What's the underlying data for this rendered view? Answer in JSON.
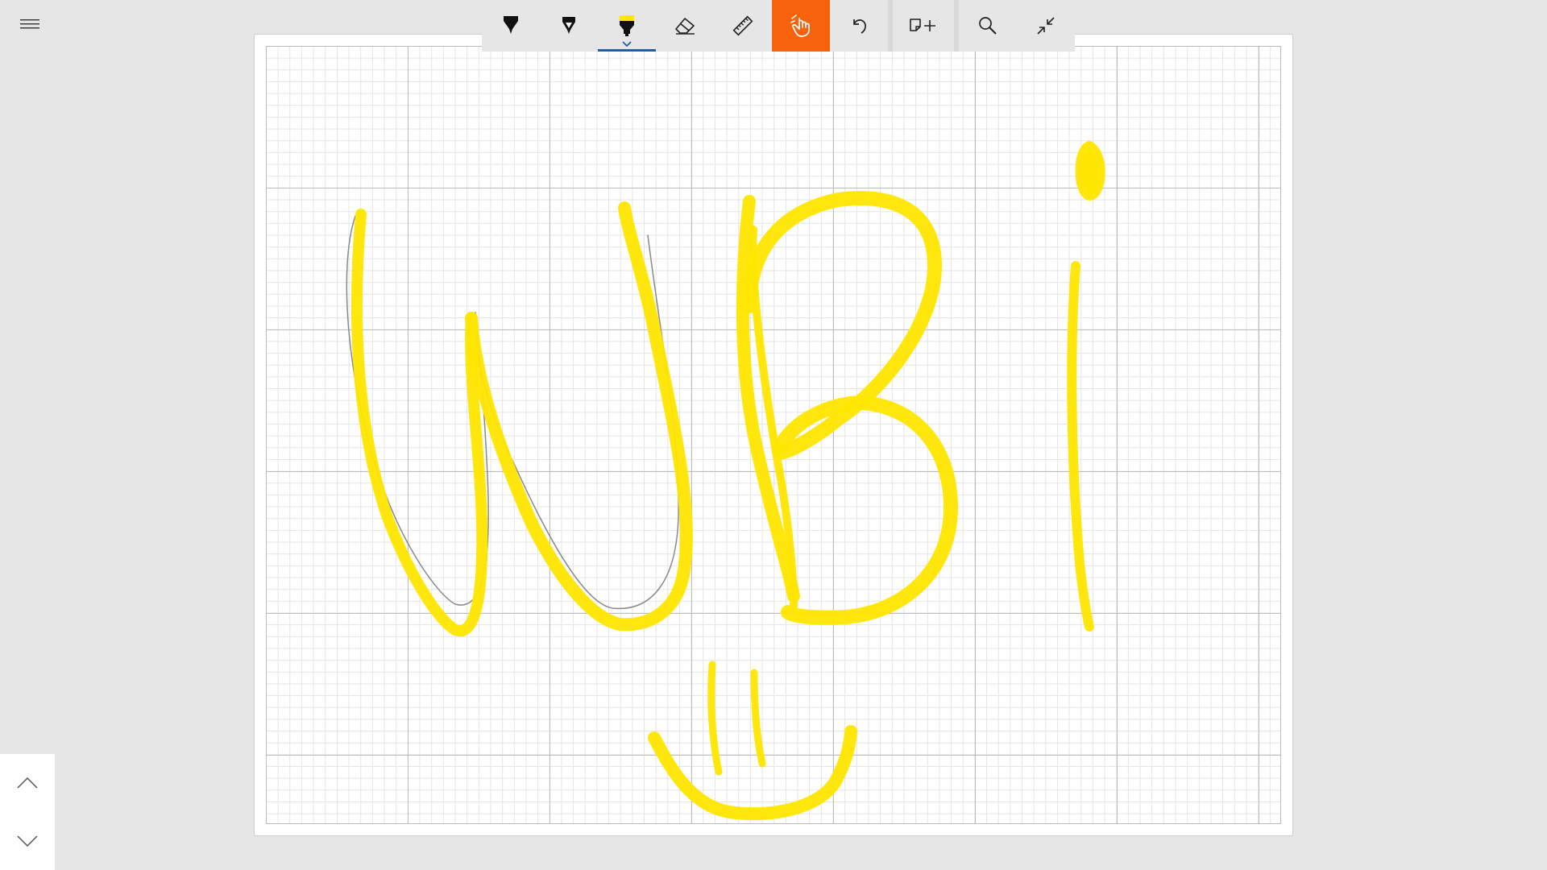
{
  "app": {
    "menu_icon": "hamburger-icon"
  },
  "toolbar": {
    "tools": [
      {
        "id": "ballpoint-pen",
        "icon": "ballpoint-pen-icon"
      },
      {
        "id": "pencil",
        "icon": "pencil-icon"
      },
      {
        "id": "highlighter",
        "icon": "highlighter-icon",
        "selected": true,
        "color": "#ffe600"
      },
      {
        "id": "eraser",
        "icon": "eraser-icon"
      },
      {
        "id": "ruler",
        "icon": "ruler-icon"
      },
      {
        "id": "touch-writing",
        "icon": "touch-writing-icon",
        "active": true
      },
      {
        "id": "undo",
        "icon": "undo-icon"
      },
      {
        "id": "add-page",
        "icon": "add-page-icon"
      },
      {
        "id": "zoom",
        "icon": "zoom-icon"
      },
      {
        "id": "exit-full-screen",
        "icon": "collapse-icon"
      }
    ]
  },
  "colors": {
    "accent_touch": "#f7630c",
    "selected_underline": "#1f5fa8",
    "highlighter_ink": "#ffe600",
    "pencil_ink": "#888888",
    "background": "#e6e6e6"
  },
  "page_nav": {
    "up_icon": "chevron-up-icon",
    "down_icon": "chevron-down-icon"
  }
}
